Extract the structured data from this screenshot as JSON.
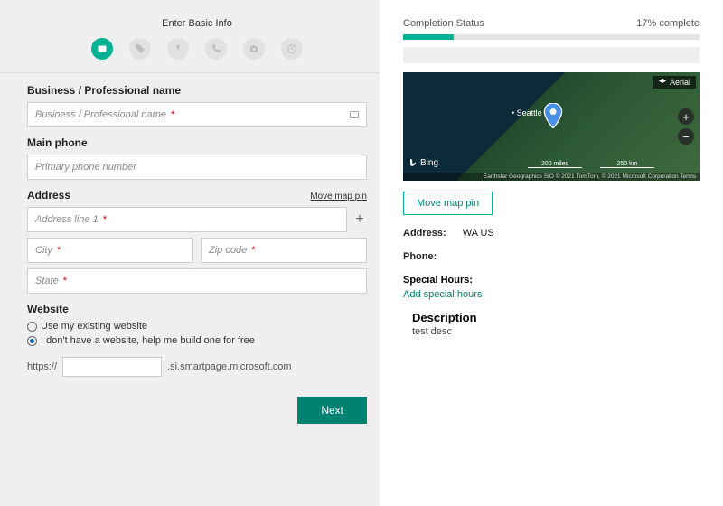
{
  "form": {
    "title": "Enter Basic Info",
    "fields": {
      "business_label": "Business / Professional name",
      "business_placeholder": "Business / Professional name",
      "phone_label": "Main phone",
      "phone_placeholder": "Primary phone number",
      "address_label": "Address",
      "move_pin_link": "Move map pin",
      "addr1_placeholder": "Address line 1",
      "city_placeholder": "City",
      "zip_placeholder": "Zip code",
      "state_placeholder": "State",
      "website_label": "Website",
      "radio_existing": "Use my existing website",
      "radio_nohave": "I don't have a website, help me build one for free",
      "url_prefix": "https://",
      "url_suffix": ".si.smartpage.microsoft.com",
      "next": "Next"
    }
  },
  "status": {
    "label": "Completion Status",
    "percent_text": "17% complete",
    "percent": 17
  },
  "map": {
    "aerial": "Aerial",
    "city": "Seattle",
    "brand": "Bing",
    "scale1": "200 miles",
    "scale2": "250 km",
    "credits": "Earthstar Geographics SIO © 2021 TomTom, © 2021 Microsoft Corporation Terms"
  },
  "preview": {
    "move_pin_btn": "Move map pin",
    "address_k": "Address:",
    "address_v": "WA US",
    "phone_k": "Phone:",
    "hours_k": "Special Hours:",
    "hours_link": "Add special hours",
    "desc_k": "Description",
    "desc_v": "test desc"
  }
}
